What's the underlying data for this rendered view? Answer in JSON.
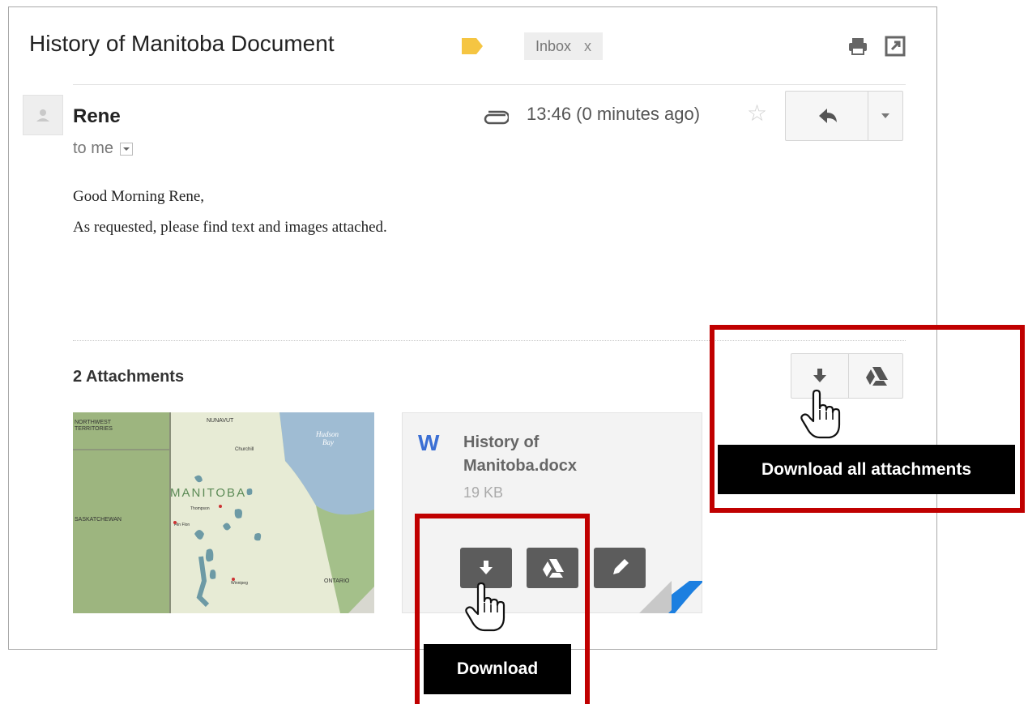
{
  "email": {
    "subject": "History of Manitoba Document",
    "label_chip": "Inbox",
    "label_chip_close": "x",
    "sender": "Rene",
    "recipient": "to me",
    "timestamp": "13:46 (0 minutes ago)",
    "body_lines": [
      "Good Morning Rene,",
      "As requested, please find text and images attached."
    ]
  },
  "attachments": {
    "title": "2 Attachments",
    "items": [
      {
        "type": "image",
        "name": "Manitoba map",
        "map_labels": [
          "NUNAVUT",
          "NORTHWEST TERRITORIES",
          "Hudson Bay",
          "MANITOBA",
          "SASKATCHEWAN",
          "ONTARIO",
          "Thompson",
          "Flin Flon",
          "Winnipeg",
          "Churchill"
        ]
      },
      {
        "type": "document",
        "icon_letter": "W",
        "name": "History of Manitoba.docx",
        "name_line1": "History of",
        "name_line2": "Manitoba.docx",
        "size": "19 KB"
      }
    ]
  },
  "annotations": {
    "download_all_tooltip": "Download all attachments",
    "download_tooltip": "Download"
  },
  "colors": {
    "highlight_box": "#c00000",
    "label_tag": "#f5c542",
    "doc_icon": "#3b6fd4",
    "dark_button": "#5c5c5c"
  },
  "icons": [
    "label-tag-icon",
    "print-icon",
    "open-new-window-icon",
    "paperclip-icon",
    "star-icon",
    "reply-icon",
    "dropdown-arrow-icon",
    "download-icon",
    "google-drive-icon",
    "edit-icon",
    "hand-cursor-icon"
  ]
}
